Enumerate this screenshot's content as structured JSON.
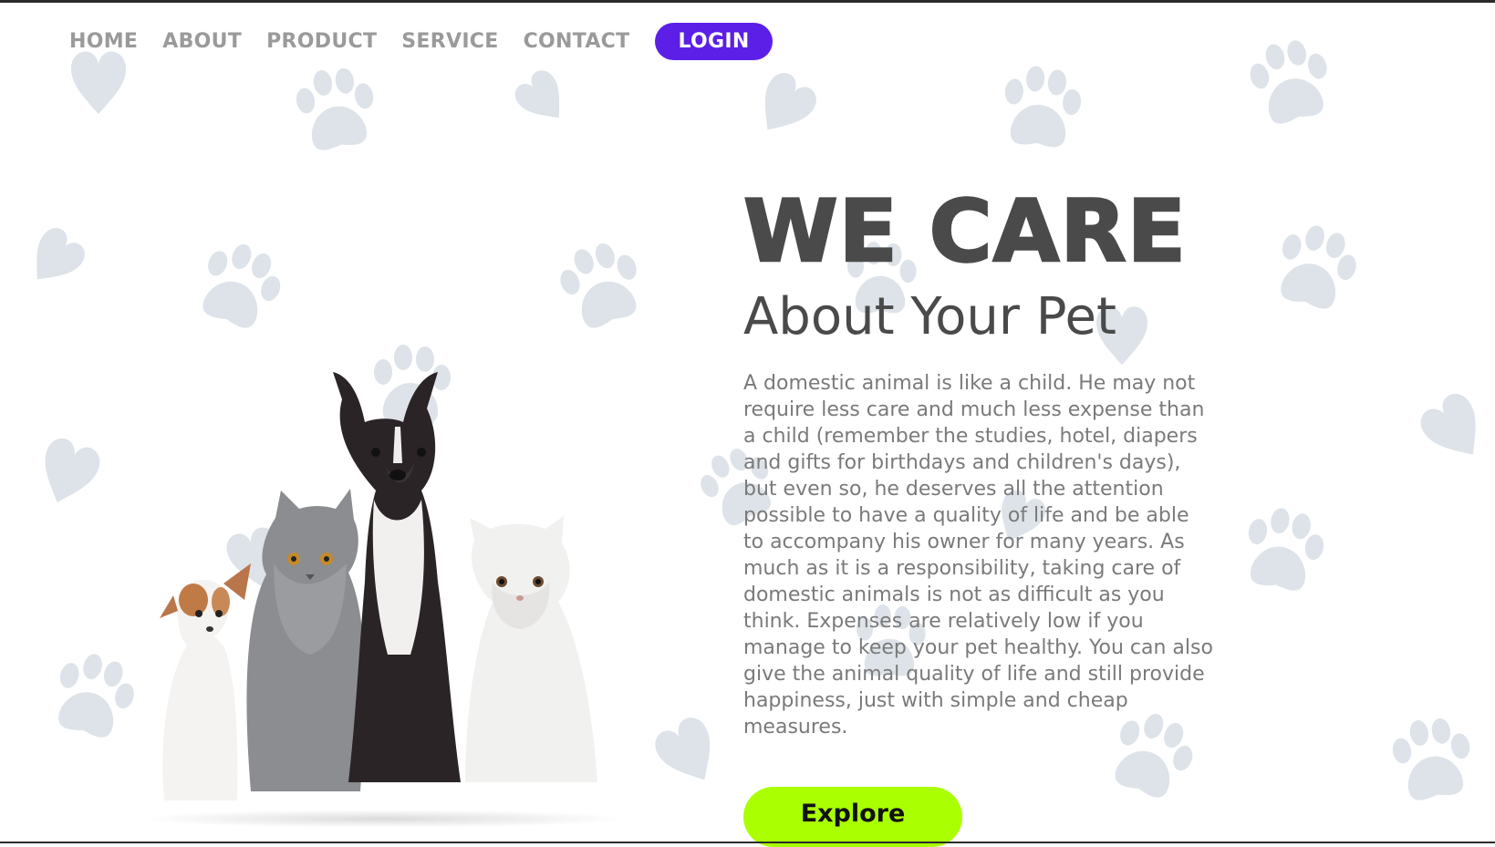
{
  "nav": {
    "items": [
      {
        "label": "HOME"
      },
      {
        "label": "ABOUT"
      },
      {
        "label": "PRODUCT"
      },
      {
        "label": "SERVICE"
      },
      {
        "label": "CONTACT"
      }
    ],
    "login_label": "LOGIN"
  },
  "hero": {
    "title": "WE CARE",
    "subtitle": "About Your Pet",
    "body": "A domestic animal is like a child. He may not require less care and much less expense than a child (remember the studies, hotel, diapers and gifts for birthdays and children's days), but even so, he deserves all the attention possible to have a quality of life and be able to accompany his owner for many years. As much as it is a responsibility, taking care of domestic animals is not as difficult as you think. Expenses are relatively low if you manage to keep your pet healthy. You can also give the animal quality of life and still provide happiness, just with simple and cheap measures.",
    "explore_label": "Explore"
  },
  "colors": {
    "accent": "#5b1fe8",
    "explore": "#aaff00",
    "decoration": "#dde3e8",
    "heading": "#4a4a4a",
    "body_text": "#7a7a7a"
  },
  "decorations": {
    "icons": [
      "paw-print-icon",
      "heart-icon"
    ]
  },
  "image": {
    "subject": "puppy, grey kitten, black bulldog, white persian cat"
  }
}
